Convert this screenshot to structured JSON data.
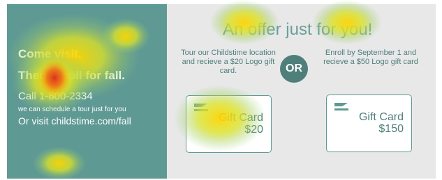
{
  "left": {
    "line1": "Come visit.",
    "line2": "Then enroll for fall.",
    "phone": "Call 1-800-2334",
    "small": "we can schedule a tour just for you",
    "visit": "Or visit childstime.com/fall"
  },
  "right": {
    "headline": "An offer just for you!",
    "offer_left": "Tour our Childstime location and recieve a $20 Logo gift card.",
    "or": "OR",
    "offer_right": "Enroll by September 1 and recieve a $50 Logo gift card",
    "card_small_label_line1": "Gift Card",
    "card_small_label_line2": "$20",
    "card_large_label_line1": "Gift Card",
    "card_large_label_line2": "$150"
  },
  "colors": {
    "panel_teal": "#5f9994",
    "accent_teal": "#4f7f7b",
    "light_gray": "#e8e8e8"
  },
  "icons": {
    "card_icon": "card-icon"
  }
}
